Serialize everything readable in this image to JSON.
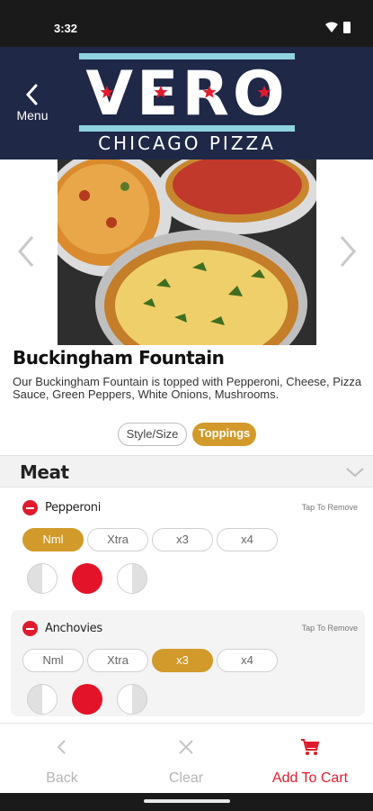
{
  "status_bar": {
    "time": "3:32"
  },
  "header": {
    "menu_label": "Menu",
    "logo_word": "VERO",
    "logo_sub": "CHICAGO PIZZA",
    "colors": {
      "navy": "#1f2847",
      "light_blue": "#8fd3e0",
      "star_red": "#e01b2d"
    }
  },
  "item": {
    "title": "Buckingham Fountain",
    "description": "Our Buckingham Fountain is topped with Pepperoni, Cheese, Pizza Sauce, Green Peppers, White Onions, Mushrooms."
  },
  "tabs": [
    {
      "label": "Style/Size",
      "active": false
    },
    {
      "label": "Toppings",
      "active": true
    }
  ],
  "section": {
    "name": "Meat"
  },
  "toppings": [
    {
      "name": "Pepperoni",
      "remove_label": "Tap To Remove",
      "options": [
        "Nml",
        "Xtra",
        "x3",
        "x4"
      ],
      "selected": "Nml",
      "coverage": "whole"
    },
    {
      "name": "Anchovies",
      "remove_label": "Tap To Remove",
      "options": [
        "Nml",
        "Xtra",
        "x3",
        "x4"
      ],
      "selected": "x3",
      "coverage": "whole"
    }
  ],
  "bottom_bar": {
    "back_label": "Back",
    "clear_label": "Clear",
    "add_label": "Add To Cart",
    "colors": {
      "disabled": "#b5b5b5",
      "accent": "#e01b2d"
    }
  },
  "accent_gold": "#d29a2a"
}
